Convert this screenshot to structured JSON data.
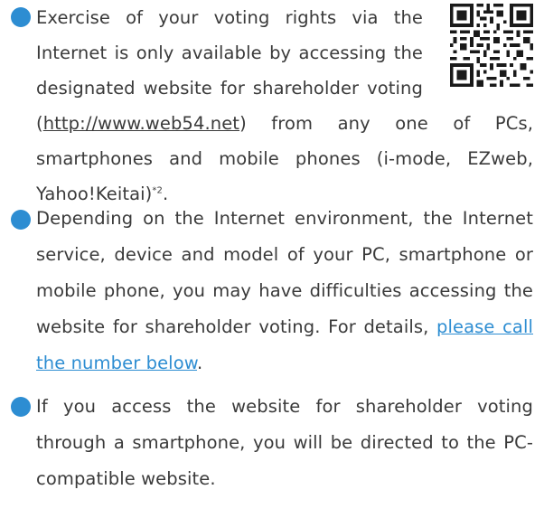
{
  "colors": {
    "accent": "#2d8dd2",
    "text": "#3a3a3a"
  },
  "icons": {
    "bullet": "bullet-circle-icon",
    "qr": "qr-code-icon"
  },
  "notes": [
    {
      "before": "Exercise of your voting rights via the Internet is only available by accessing the designated website for shareholder voting (",
      "url": "http://www.web54.net",
      "after": ") from any one of PCs, smartphones and mobile phones (i-mode, EZweb, Yahoo!Keitai)",
      "footnote": "*2",
      "end": "."
    },
    {
      "before": "Depending on the Internet environment, the Internet service, device and model of your PC, smartphone or mobile phone, you may have difficulties accessing the website for shareholder voting. For details, ",
      "link": "please call the number below",
      "end": "."
    },
    {
      "text": "If you access the website for shareholder voting through a smartphone, you will be directed to the PC-compatible website."
    }
  ]
}
